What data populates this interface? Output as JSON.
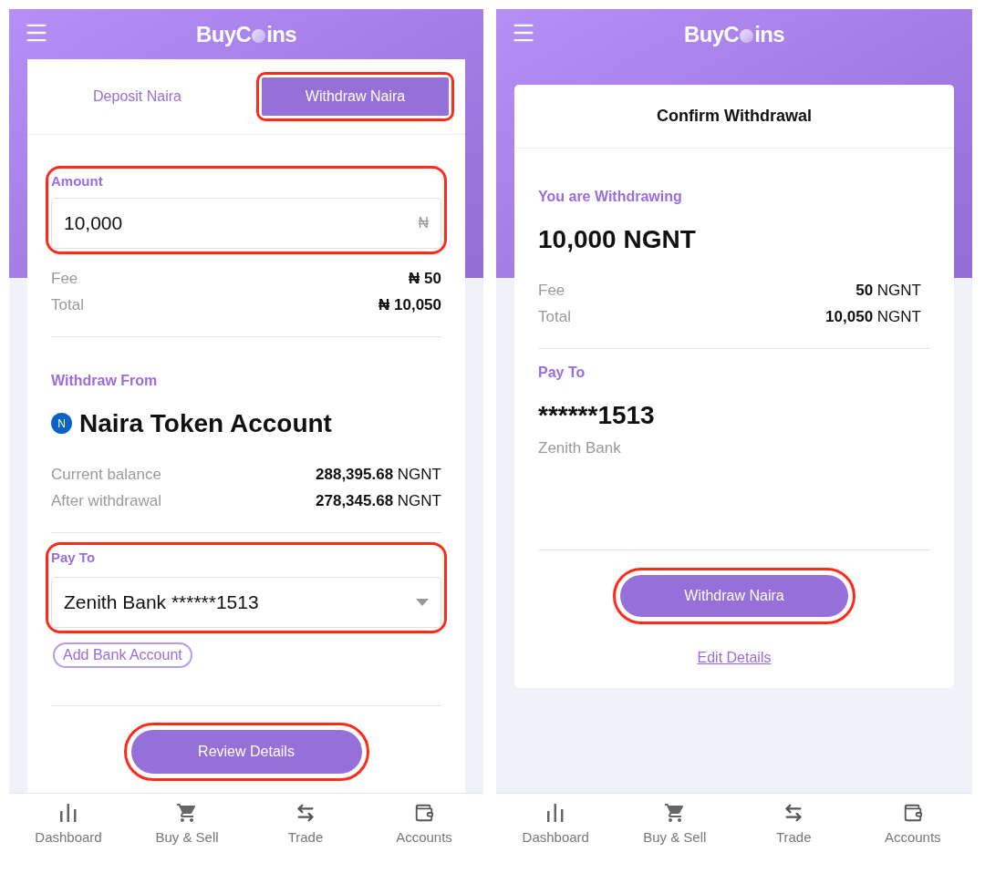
{
  "withdraw_screen": {
    "logo": [
      "BuyC",
      "ins"
    ],
    "tabs": [
      {
        "label": "Deposit Naira",
        "selected": false,
        "highlighted": false
      },
      {
        "label": "Withdraw Naira",
        "selected": true,
        "highlighted": true
      }
    ],
    "amount": {
      "label": "Amount",
      "value": "10,000",
      "currency": "₦",
      "highlighted": true
    },
    "charges": [
      {
        "label": "Fee",
        "value": "₦ 50"
      },
      {
        "label": "Total",
        "value": "₦ 10,050"
      }
    ],
    "source": {
      "label": "Withdraw From",
      "badge": "N",
      "account": "Naira Token Account"
    },
    "balances": [
      {
        "label": "Current balance",
        "value": "288,395.68",
        "unit": "NGNT"
      },
      {
        "label": "After withdrawal",
        "value": "278,345.68",
        "unit": "NGNT"
      }
    ],
    "pay_to": {
      "label": "Pay To",
      "value": "Zenith Bank ******1513",
      "highlighted": true
    },
    "add_account": "Add Bank Account",
    "submit": {
      "label": "Review Details",
      "highlighted": true
    },
    "nav": [
      "Dashboard",
      "Buy & Sell",
      "Trade",
      "Accounts"
    ]
  },
  "confirm_screen": {
    "logo": [
      "BuyC",
      "ins"
    ],
    "title": "Confirm Withdrawal",
    "amount_label": "You are Withdrawing",
    "amount": "10,000 NGNT",
    "charges": [
      {
        "label": "Fee",
        "value": "50",
        "unit": "NGNT"
      },
      {
        "label": "Total",
        "value": "10,050",
        "unit": "NGNT"
      }
    ],
    "pay_to": {
      "label": "Pay To",
      "account": "******1513",
      "bank": "Zenith Bank"
    },
    "submit": {
      "label": "Withdraw Naira",
      "highlighted": true
    },
    "edit_link": "Edit Details",
    "nav": [
      "Dashboard",
      "Buy & Sell",
      "Trade",
      "Accounts"
    ]
  }
}
